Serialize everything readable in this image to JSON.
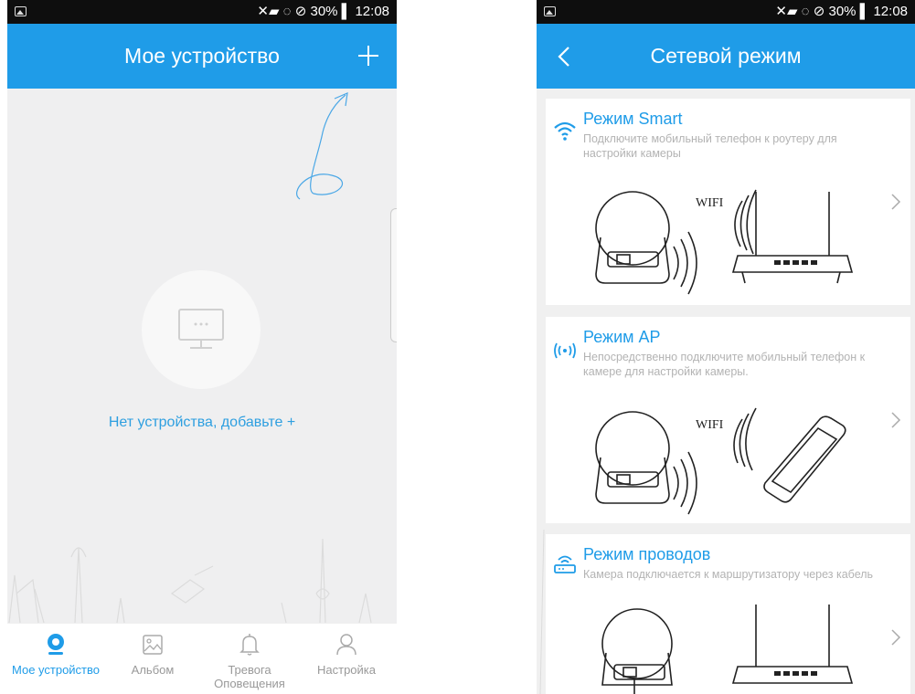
{
  "left_screen": {
    "status_bar": {
      "right_text": "✕▰ ◌ ⊘ 30% ▌ 12:08"
    },
    "header": {
      "title": "Мое устройство"
    },
    "empty_state": {
      "text": "Нет устройства, добавьте +"
    },
    "tabs": [
      {
        "label": "Мое устройство",
        "icon": "camera-icon",
        "active": true
      },
      {
        "label": "Альбом",
        "icon": "album-icon",
        "active": false
      },
      {
        "label": "Тревога Оповещения",
        "icon": "bell-icon",
        "active": false
      },
      {
        "label": "Настройка",
        "icon": "user-icon",
        "active": false
      }
    ]
  },
  "right_screen": {
    "status_bar": {
      "right_text": "✕▰ ◌ ⊘ 30% ▌ 12:08"
    },
    "header": {
      "title": "Сетевой режим"
    },
    "modes": [
      {
        "title": "Режим Smart",
        "description": "Подключите мобильный телефон к роутеру для настройки камеры",
        "icon": "wifi-icon",
        "illustration_label": "WIFI"
      },
      {
        "title": "Режим AP",
        "description": "Непосредственно подключите мобильный телефон к камере для настройки камеры.",
        "icon": "ap-signal-icon",
        "illustration_label": "WIFI"
      },
      {
        "title": "Режим проводов",
        "description": "Камера подключается к маршрутизатору через кабель",
        "icon": "router-icon"
      }
    ]
  },
  "colors": {
    "accent": "#1f9ce8",
    "status_bar": "#0e0e0e",
    "muted_text": "#b3b3b3"
  }
}
